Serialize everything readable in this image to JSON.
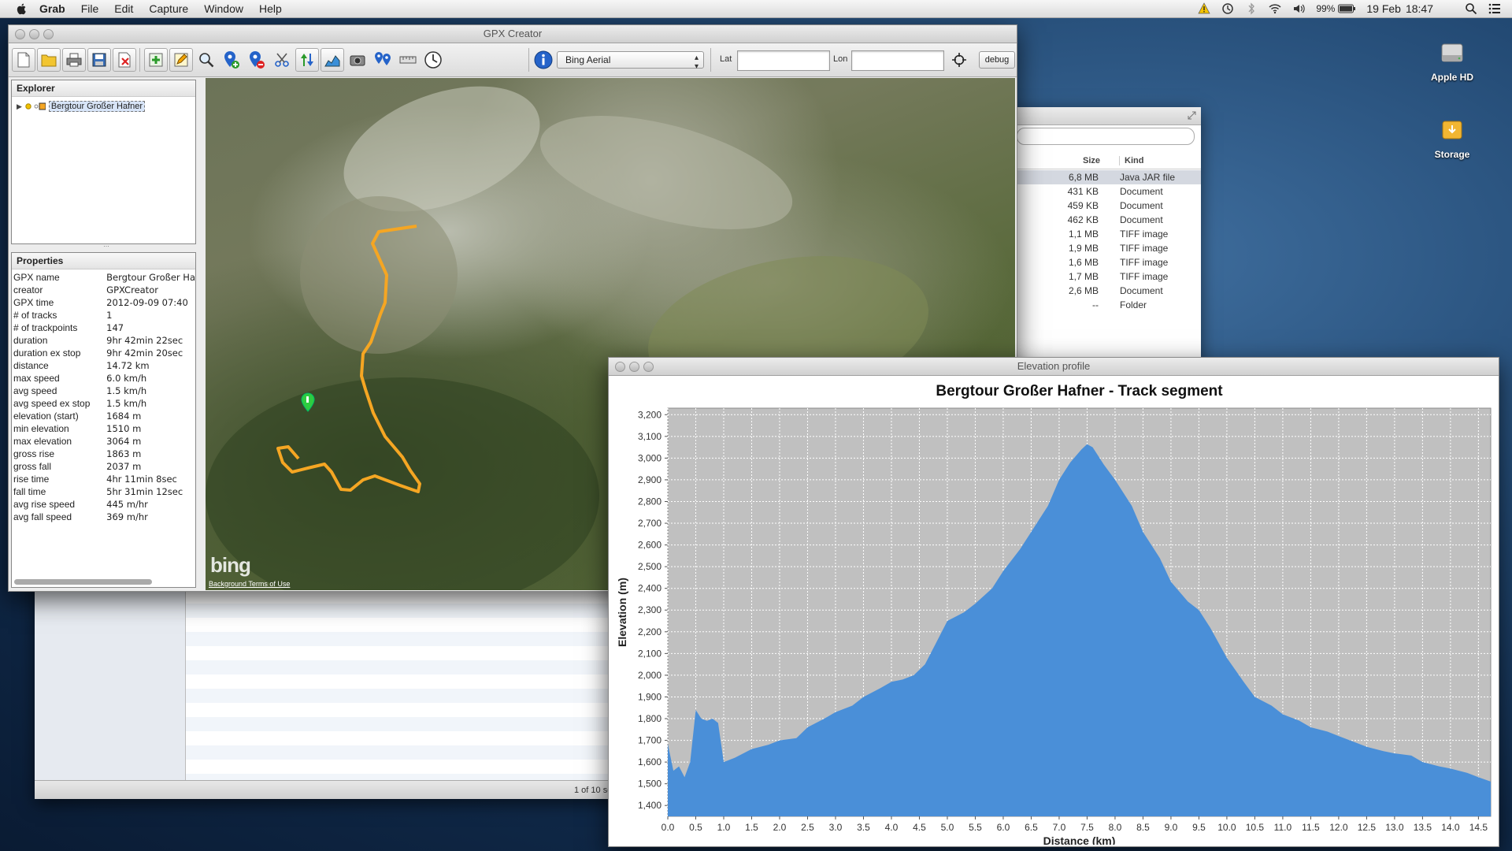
{
  "menubar": {
    "app": "Grab",
    "items": [
      "File",
      "Edit",
      "Capture",
      "Window",
      "Help"
    ],
    "battery": "99%",
    "date": "19 Feb",
    "time": "18:47"
  },
  "desktop": {
    "icons": [
      {
        "label": "Apple HD",
        "icon": "hard-drive-icon"
      },
      {
        "label": "Storage",
        "icon": "external-drive-icon"
      }
    ]
  },
  "finder": {
    "status": "1 of 10 selected",
    "columns": {
      "size": "Size",
      "kind": "Kind"
    },
    "rows": [
      {
        "size": "6,8 MB",
        "kind": "Java JAR file",
        "selected": true
      },
      {
        "size": "431 KB",
        "kind": "Document"
      },
      {
        "size": "459 KB",
        "kind": "Document"
      },
      {
        "size": "462 KB",
        "kind": "Document"
      },
      {
        "size": "1,1 MB",
        "kind": "TIFF image"
      },
      {
        "size": "1,9 MB",
        "kind": "TIFF image"
      },
      {
        "size": "1,6 MB",
        "kind": "TIFF image"
      },
      {
        "size": "1,7 MB",
        "kind": "TIFF image"
      },
      {
        "size": "2,6 MB",
        "kind": "Document"
      },
      {
        "size": "--",
        "kind": "Folder"
      }
    ]
  },
  "gpx": {
    "title": "GPX Creator",
    "map_source": "Bing Aerial",
    "lat_label": "Lat",
    "lon_label": "Lon",
    "lat_value": "",
    "lon_value": "",
    "debug_label": "debug",
    "explorer": {
      "title": "Explorer",
      "node": "Bergtour Großer Hafner"
    },
    "properties": {
      "title": "Properties",
      "rows": [
        [
          "GPX name",
          "Bergtour Großer Ha"
        ],
        [
          "creator",
          "GPXCreator"
        ],
        [
          "GPX time",
          "2012-09-09 07:40"
        ],
        [
          "# of tracks",
          "1"
        ],
        [
          "# of trackpoints",
          "147"
        ],
        [
          "duration",
          "9hr 42min 22sec"
        ],
        [
          "duration ex stop",
          "9hr 42min 20sec"
        ],
        [
          "distance",
          "14.72 km"
        ],
        [
          "max speed",
          "6.0 km/h"
        ],
        [
          "avg speed",
          "1.5 km/h"
        ],
        [
          "avg speed ex stop",
          "1.5 km/h"
        ],
        [
          "elevation (start)",
          "1684 m"
        ],
        [
          "min elevation",
          "1510 m"
        ],
        [
          "max elevation",
          "3064 m"
        ],
        [
          "gross rise",
          "1863 m"
        ],
        [
          "gross fall",
          "2037 m"
        ],
        [
          "rise time",
          "4hr 11min 8sec"
        ],
        [
          "fall time",
          "5hr 31min 12sec"
        ],
        [
          "avg rise speed",
          "445 m/hr"
        ],
        [
          "avg fall speed",
          "369 m/hr"
        ]
      ]
    },
    "map": {
      "brand": "bing",
      "terms": "Background Terms of Use",
      "track_color": "#f5a623",
      "marker_color": "#2ecc40"
    }
  },
  "elevation_window": {
    "title": "Elevation profile"
  },
  "chart_data": {
    "type": "area",
    "title": "Bergtour Großer Hafner - Track segment",
    "xlabel": "Distance (km)",
    "ylabel": "Elevation (m)",
    "xlim": [
      0,
      14.72
    ],
    "ylim": [
      1350,
      3230
    ],
    "xticks": [
      "0.0",
      "0.5",
      "1.0",
      "1.5",
      "2.0",
      "2.5",
      "3.0",
      "3.5",
      "4.0",
      "4.5",
      "5.0",
      "5.5",
      "6.0",
      "6.5",
      "7.0",
      "7.5",
      "8.0",
      "8.5",
      "9.0",
      "9.5",
      "10.0",
      "10.5",
      "11.0",
      "11.5",
      "12.0",
      "12.5",
      "13.0",
      "13.5",
      "14.0",
      "14.5"
    ],
    "yticks": [
      "1,400",
      "1,500",
      "1,600",
      "1,700",
      "1,800",
      "1,900",
      "2,000",
      "2,100",
      "2,200",
      "2,300",
      "2,400",
      "2,500",
      "2,600",
      "2,700",
      "2,800",
      "2,900",
      "3,000",
      "3,100",
      "3,200"
    ],
    "grid": true,
    "fill_color": "#4a8fd8",
    "plot_bg": "#c0c0c0",
    "x": [
      0.0,
      0.1,
      0.2,
      0.3,
      0.4,
      0.5,
      0.6,
      0.7,
      0.8,
      0.9,
      1.0,
      1.2,
      1.5,
      1.8,
      2.0,
      2.3,
      2.5,
      2.8,
      3.0,
      3.3,
      3.5,
      3.8,
      4.0,
      4.2,
      4.4,
      4.6,
      4.8,
      5.0,
      5.3,
      5.5,
      5.8,
      6.0,
      6.3,
      6.5,
      6.8,
      7.0,
      7.2,
      7.4,
      7.5,
      7.6,
      7.8,
      8.0,
      8.3,
      8.5,
      8.8,
      9.0,
      9.3,
      9.5,
      9.7,
      10.0,
      10.3,
      10.5,
      10.8,
      11.0,
      11.3,
      11.5,
      11.8,
      12.0,
      12.3,
      12.5,
      12.8,
      13.0,
      13.3,
      13.5,
      13.8,
      14.0,
      14.3,
      14.5,
      14.72
    ],
    "values": [
      1684,
      1560,
      1580,
      1530,
      1600,
      1840,
      1800,
      1790,
      1800,
      1780,
      1600,
      1620,
      1660,
      1680,
      1700,
      1710,
      1760,
      1800,
      1830,
      1860,
      1900,
      1940,
      1970,
      1980,
      2000,
      2050,
      2150,
      2250,
      2290,
      2330,
      2400,
      2480,
      2580,
      2660,
      2780,
      2900,
      2980,
      3040,
      3064,
      3050,
      2970,
      2900,
      2780,
      2660,
      2540,
      2430,
      2340,
      2300,
      2220,
      2080,
      1970,
      1900,
      1860,
      1820,
      1790,
      1760,
      1740,
      1720,
      1690,
      1670,
      1650,
      1640,
      1630,
      1600,
      1580,
      1570,
      1550,
      1530,
      1510
    ]
  }
}
